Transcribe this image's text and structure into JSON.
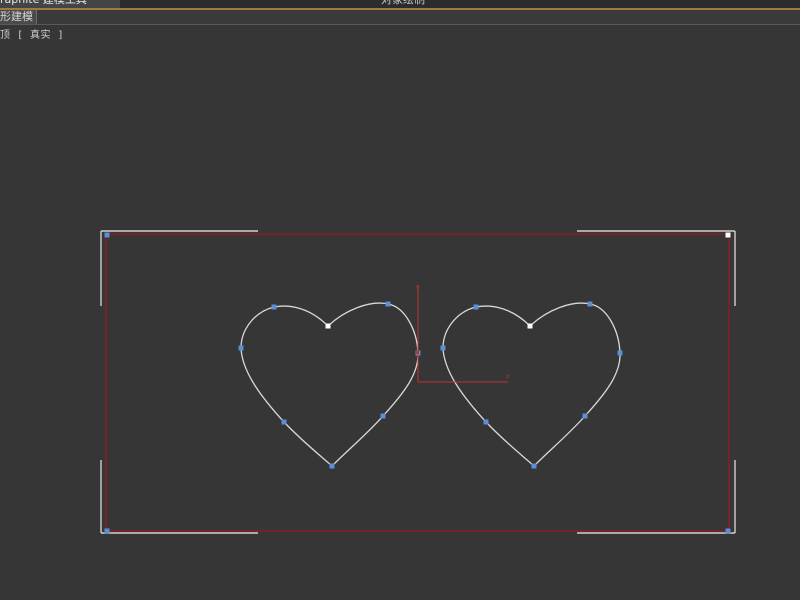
{
  "ribbon": {
    "tabs": [
      {
        "label": "raphite 建模工具",
        "active": true
      },
      {
        "label": "",
        "active": false
      },
      {
        "label": "",
        "active": false
      },
      {
        "label": "对象绘制",
        "active": false
      },
      {
        "label": "",
        "active": false
      }
    ],
    "accent_color": "#a07a3c"
  },
  "subtabs": [
    {
      "label": "形建模"
    }
  ],
  "viewport": {
    "label": "顶 [ 真实 ]",
    "background_color": "#363636",
    "gizmo": {
      "x_label": "x",
      "y_label": "y",
      "color": "#c03030"
    },
    "colors": {
      "spline": "#d8d8d8",
      "vertex": "#5b8fd8",
      "first_vertex": "#ffffff",
      "selection_box": "#8e1c1c",
      "bracket": "#d0d0d0"
    }
  }
}
